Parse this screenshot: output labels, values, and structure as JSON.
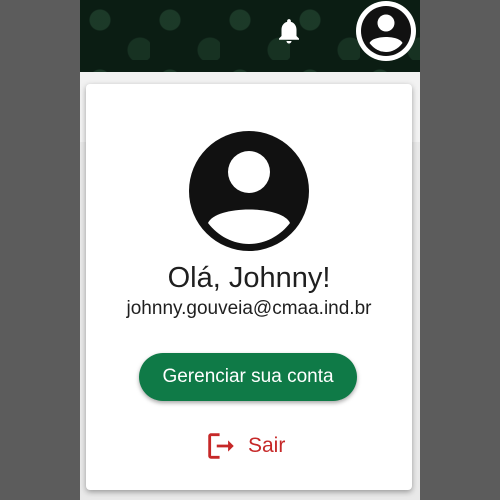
{
  "header": {
    "notification_icon": "bell-icon",
    "profile_icon": "account-circle-icon"
  },
  "account_card": {
    "avatar_icon": "account-circle-icon",
    "greeting": "Olá, Johnny!",
    "email": "johnny.gouveia@cmaa.ind.br",
    "manage_account_label": "Gerenciar sua conta",
    "sign_out_label": "Sair",
    "sign_out_icon": "logout-icon"
  },
  "colors": {
    "header_bg": "#0b1d13",
    "primary_button": "#0f7a47",
    "sign_out_red": "#c62828"
  }
}
